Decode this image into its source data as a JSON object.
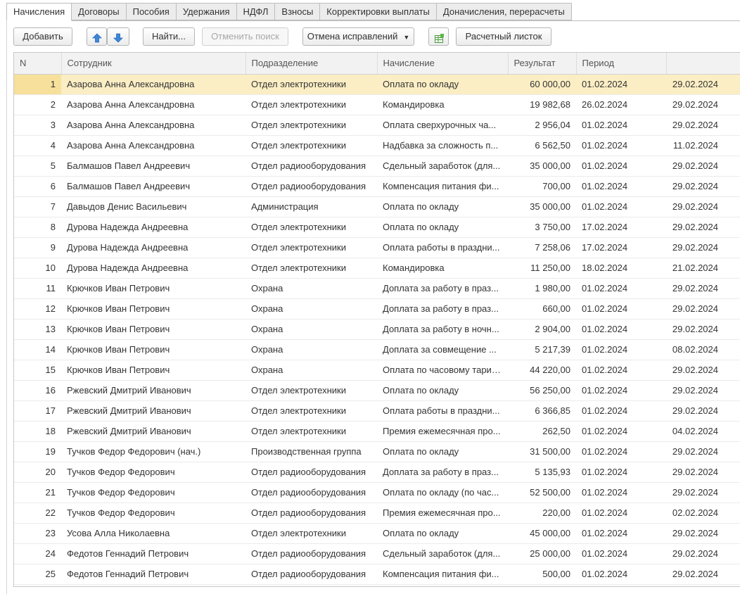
{
  "tabs": [
    "Начисления",
    "Договоры",
    "Пособия",
    "Удержания",
    "НДФЛ",
    "Взносы",
    "Корректировки выплаты",
    "Доначисления, перерасчеты"
  ],
  "toolbar": {
    "add_label": "Добавить",
    "find_label": "Найти...",
    "cancel_search_label": "Отменить поиск",
    "cancel_corrections_label": "Отмена исправлений",
    "payslip_label": "Расчетный листок"
  },
  "grid": {
    "columns": [
      "N",
      "Сотрудник",
      "Подразделение",
      "Начисление",
      "Результат",
      "Период",
      ""
    ],
    "selected_row": 1,
    "rows": [
      [
        "1",
        "Азарова Анна Александровна",
        "Отдел электротехники",
        "Оплата по окладу",
        "60 000,00",
        "01.02.2024",
        "29.02.2024"
      ],
      [
        "2",
        "Азарова Анна Александровна",
        "Отдел электротехники",
        "Командировка",
        "19 982,68",
        "26.02.2024",
        "29.02.2024"
      ],
      [
        "3",
        "Азарова Анна Александровна",
        "Отдел электротехники",
        "Оплата сверхурочных ча...",
        "2 956,04",
        "01.02.2024",
        "29.02.2024"
      ],
      [
        "4",
        "Азарова Анна Александровна",
        "Отдел электротехники",
        "Надбавка за сложность п...",
        "6 562,50",
        "01.02.2024",
        "11.02.2024"
      ],
      [
        "5",
        "Балмашов Павел Андреевич",
        "Отдел радиооборудования",
        "Сдельный заработок (для...",
        "35 000,00",
        "01.02.2024",
        "29.02.2024"
      ],
      [
        "6",
        "Балмашов Павел Андреевич",
        "Отдел радиооборудования",
        "Компенсация питания фи...",
        "700,00",
        "01.02.2024",
        "29.02.2024"
      ],
      [
        "7",
        "Давыдов Денис Васильевич",
        "Администрация",
        "Оплата по окладу",
        "35 000,00",
        "01.02.2024",
        "29.02.2024"
      ],
      [
        "8",
        "Дурова Надежда Андреевна",
        "Отдел электротехники",
        "Оплата по окладу",
        "3 750,00",
        "17.02.2024",
        "29.02.2024"
      ],
      [
        "9",
        "Дурова Надежда Андреевна",
        "Отдел электротехники",
        "Оплата работы в праздни...",
        "7 258,06",
        "17.02.2024",
        "29.02.2024"
      ],
      [
        "10",
        "Дурова Надежда Андреевна",
        "Отдел электротехники",
        "Командировка",
        "11 250,00",
        "18.02.2024",
        "21.02.2024"
      ],
      [
        "11",
        "Крючков Иван Петрович",
        "Охрана",
        "Доплата за работу в праз...",
        "1 980,00",
        "01.02.2024",
        "29.02.2024"
      ],
      [
        "12",
        "Крючков Иван Петрович",
        "Охрана",
        "Доплата за работу в праз...",
        "660,00",
        "01.02.2024",
        "29.02.2024"
      ],
      [
        "13",
        "Крючков Иван Петрович",
        "Охрана",
        "Доплата за работу в ночн...",
        "2 904,00",
        "01.02.2024",
        "29.02.2024"
      ],
      [
        "14",
        "Крючков Иван Петрович",
        "Охрана",
        "Доплата за совмещение ...",
        "5 217,39",
        "01.02.2024",
        "08.02.2024"
      ],
      [
        "15",
        "Крючков Иван Петрович",
        "Охрана",
        "Оплата по часовому тарифу",
        "44 220,00",
        "01.02.2024",
        "29.02.2024"
      ],
      [
        "16",
        "Ржевский Дмитрий Иванович",
        "Отдел электротехники",
        "Оплата по окладу",
        "56 250,00",
        "01.02.2024",
        "29.02.2024"
      ],
      [
        "17",
        "Ржевский Дмитрий Иванович",
        "Отдел электротехники",
        "Оплата работы в праздни...",
        "6 366,85",
        "01.02.2024",
        "29.02.2024"
      ],
      [
        "18",
        "Ржевский Дмитрий Иванович",
        "Отдел электротехники",
        "Премия ежемесячная про...",
        "262,50",
        "01.02.2024",
        "04.02.2024"
      ],
      [
        "19",
        "Тучков Федор Федорович (нач.)",
        "Производственная группа",
        "Оплата по окладу",
        "31 500,00",
        "01.02.2024",
        "29.02.2024"
      ],
      [
        "20",
        "Тучков Федор Федорович",
        "Отдел радиооборудования",
        "Доплата за работу в праз...",
        "5 135,93",
        "01.02.2024",
        "29.02.2024"
      ],
      [
        "21",
        "Тучков Федор Федорович",
        "Отдел радиооборудования",
        "Оплата по окладу (по час...",
        "52 500,00",
        "01.02.2024",
        "29.02.2024"
      ],
      [
        "22",
        "Тучков Федор Федорович",
        "Отдел радиооборудования",
        "Премия ежемесячная про...",
        "220,00",
        "01.02.2024",
        "02.02.2024"
      ],
      [
        "23",
        "Усова Алла Николаевна",
        "Отдел электротехники",
        "Оплата по окладу",
        "45 000,00",
        "01.02.2024",
        "29.02.2024"
      ],
      [
        "24",
        "Федотов Геннадий Петрович",
        "Отдел радиооборудования",
        "Сдельный заработок (для...",
        "25 000,00",
        "01.02.2024",
        "29.02.2024"
      ],
      [
        "25",
        "Федотов Геннадий Петрович",
        "Отдел радиооборудования",
        "Компенсация питания фи...",
        "500,00",
        "01.02.2024",
        "29.02.2024"
      ]
    ]
  }
}
